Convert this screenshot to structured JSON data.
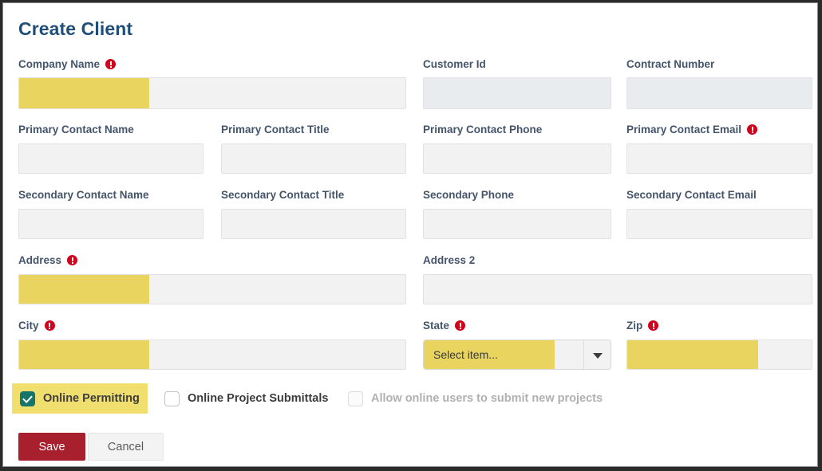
{
  "form": {
    "title": "Create Client",
    "required_icon": "required-alert-icon"
  },
  "colors": {
    "title": "#1f4e79",
    "highlight": "#e8d45e",
    "required": "#d0021b",
    "save_button": "#a81f2d",
    "checkbox_checked": "#16756a",
    "field_background": "#f2f2f2",
    "field_background_readonly": "#e8ecef"
  },
  "fields": [
    {
      "label": "Company Name",
      "required": true,
      "value": "",
      "placeholder": ""
    },
    {
      "label": "Customer Id",
      "required": false,
      "value": "",
      "placeholder": ""
    },
    {
      "label": "Contract Number",
      "required": false,
      "value": "",
      "placeholder": ""
    },
    {
      "label": "Primary Contact Name",
      "required": false,
      "value": "",
      "placeholder": ""
    },
    {
      "label": "Primary Contact Title",
      "required": false,
      "value": "",
      "placeholder": ""
    },
    {
      "label": "Primary Contact Phone",
      "required": false,
      "value": "",
      "placeholder": ""
    },
    {
      "label": "Primary Contact Email",
      "required": true,
      "value": "",
      "placeholder": ""
    },
    {
      "label": "Secondary Contact Name",
      "required": false,
      "value": "",
      "placeholder": ""
    },
    {
      "label": "Secondary Contact Title",
      "required": false,
      "value": "",
      "placeholder": ""
    },
    {
      "label": "Secondary Phone",
      "required": false,
      "value": "",
      "placeholder": ""
    },
    {
      "label": "Secondary Contact Email",
      "required": false,
      "value": "",
      "placeholder": ""
    },
    {
      "label": "Address",
      "required": true,
      "value": "",
      "placeholder": ""
    },
    {
      "label": "Address 2",
      "required": false,
      "value": "",
      "placeholder": ""
    },
    {
      "label": "City",
      "required": true,
      "value": "",
      "placeholder": ""
    },
    {
      "label": "State",
      "required": true,
      "value": "Select item...",
      "placeholder": "Select item..."
    },
    {
      "label": "Zip",
      "required": true,
      "value": "",
      "placeholder": ""
    }
  ],
  "checkboxes": [
    {
      "label": "Online Permitting",
      "checked": true,
      "disabled": false,
      "highlighted": true
    },
    {
      "label": "Online Project Submittals",
      "checked": false,
      "disabled": false,
      "highlighted": false
    },
    {
      "label": "Allow online users to submit new projects",
      "checked": false,
      "disabled": true,
      "highlighted": false
    }
  ],
  "buttons": {
    "save": "Save",
    "cancel": "Cancel"
  }
}
